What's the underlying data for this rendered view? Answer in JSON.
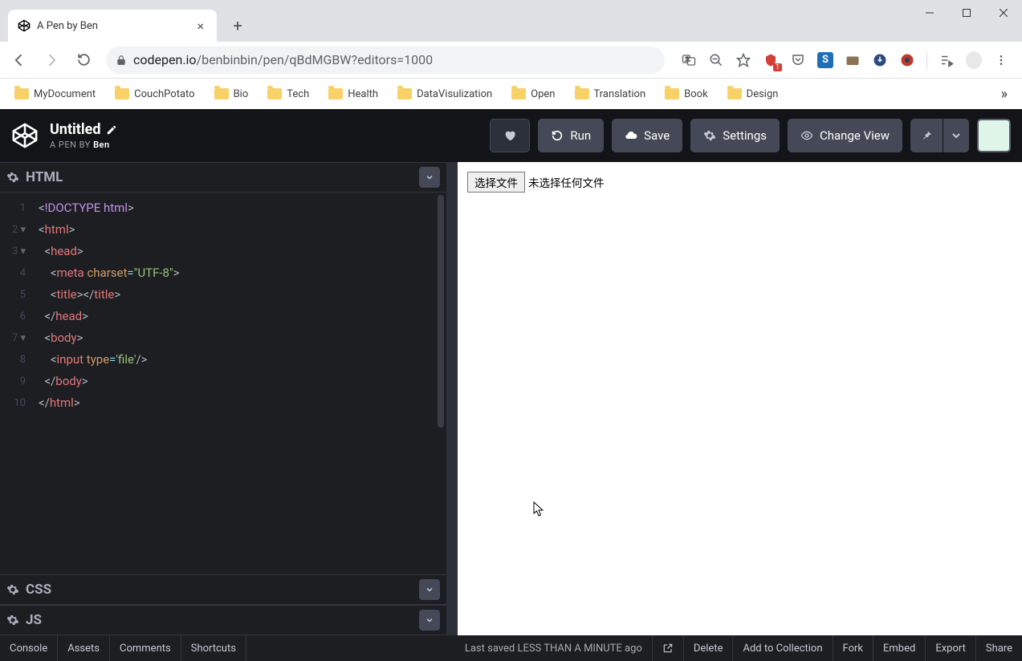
{
  "browser": {
    "tab_title": "A Pen by Ben",
    "url_host": "codepen.io",
    "url_path": "/benbinbin/pen/qBdMGBW?editors=1000",
    "bookmarks": [
      "MyDocument",
      "CouchPotato",
      "Bio",
      "Tech",
      "Health",
      "DataVisulization",
      "Open",
      "Translation",
      "Book",
      "Design"
    ]
  },
  "codepen": {
    "title": "Untitled",
    "byline_prefix": "A PEN BY ",
    "byline_author": "Ben",
    "btn_run": "Run",
    "btn_save": "Save",
    "btn_settings": "Settings",
    "btn_changeview": "Change View"
  },
  "panels": {
    "html": "HTML",
    "css": "CSS",
    "js": "JS"
  },
  "code": {
    "line_numbers": [
      "1",
      "2",
      "3",
      "4",
      "5",
      "6",
      "7",
      "8",
      "9",
      "10"
    ],
    "folds": {
      "2": "▾",
      "3": "▾",
      "7": "▾"
    }
  },
  "preview": {
    "file_button": "选择文件",
    "file_status": "未选择任何文件"
  },
  "footer": {
    "left": [
      "Console",
      "Assets",
      "Comments",
      "Shortcuts"
    ],
    "saved_prefix": "Last saved ",
    "saved_time": "LESS THAN A MINUTE",
    "saved_suffix": " ago",
    "right": [
      "Delete",
      "Add to Collection",
      "Fork",
      "Embed",
      "Export",
      "Share"
    ]
  }
}
